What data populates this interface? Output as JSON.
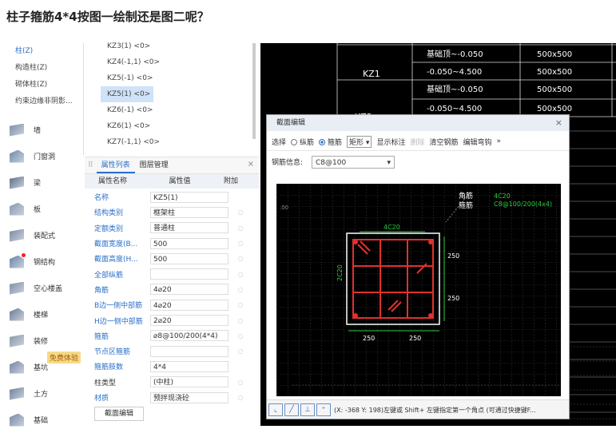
{
  "question": "柱子箍筋4*4按图一绘制还是图二呢？",
  "top_glyph": "^",
  "categories": [
    {
      "label": "柱(Z)",
      "selected": true
    },
    {
      "label": "构造柱(Z)",
      "selected": false
    },
    {
      "label": "砌体柱(Z)",
      "selected": false
    },
    {
      "label": "约束边缘非阴影...",
      "selected": false
    }
  ],
  "nav": [
    {
      "label": "墙",
      "icon": "wall-icon"
    },
    {
      "label": "门窗洞",
      "icon": "door-window-icon"
    },
    {
      "label": "梁",
      "icon": "beam-icon"
    },
    {
      "label": "板",
      "icon": "slab-icon"
    },
    {
      "label": "装配式",
      "icon": "prefab-icon"
    },
    {
      "label": "钢结构",
      "icon": "steel-structure-icon"
    },
    {
      "label": "空心楼盖",
      "icon": "hollow-floor-icon"
    },
    {
      "label": "楼梯",
      "icon": "stair-icon"
    },
    {
      "label": "装修",
      "icon": "decoration-icon"
    },
    {
      "label": "基坑",
      "icon": "pit-icon"
    },
    {
      "label": "土方",
      "icon": "earthwork-icon"
    },
    {
      "label": "基础",
      "icon": "foundation-icon"
    }
  ],
  "free_badge": "免费体验",
  "components": [
    {
      "label": "KZ3(1) <0>",
      "selected": false
    },
    {
      "label": "KZ4(-1,1) <0>",
      "selected": false
    },
    {
      "label": "KZ5(-1) <0>",
      "selected": false
    },
    {
      "label": "KZ5(1) <0>",
      "selected": true
    },
    {
      "label": "KZ6(-1) <0>",
      "selected": false
    },
    {
      "label": "KZ6(1) <0>",
      "selected": false
    },
    {
      "label": "KZ7(-1,1) <0>",
      "selected": false
    }
  ],
  "props": {
    "tabs": [
      "属性列表",
      "图层管理"
    ],
    "grip": "⠿",
    "close": "×",
    "headers": [
      "属性名称",
      "属性值",
      "附加"
    ],
    "rows": [
      {
        "name": "名称",
        "value": "KZ5(1)",
        "link": true,
        "check": false
      },
      {
        "name": "结构类别",
        "value": "框架柱",
        "link": true,
        "check": true
      },
      {
        "name": "定额类别",
        "value": "普通柱",
        "link": true,
        "check": true
      },
      {
        "name": "截面宽度(B...",
        "value": "500",
        "link": true,
        "check": true
      },
      {
        "name": "截面高度(H...",
        "value": "500",
        "link": true,
        "check": true
      },
      {
        "name": "全部纵筋",
        "value": "",
        "link": true,
        "check": true
      },
      {
        "name": "角筋",
        "value": "4⌀20",
        "link": true,
        "check": true
      },
      {
        "name": "B边一侧中部筋",
        "value": "4⌀20",
        "link": true,
        "check": true
      },
      {
        "name": "H边一侧中部筋",
        "value": "2⌀20",
        "link": true,
        "check": true
      },
      {
        "name": "箍筋",
        "value": "⌀8@100/200(4*4)",
        "link": true,
        "check": true
      },
      {
        "name": "节点区箍筋",
        "value": "",
        "link": true,
        "check": true
      },
      {
        "name": "箍筋肢数",
        "value": "4*4",
        "link": true,
        "check": false
      },
      {
        "name": "柱类型",
        "value": "(中柱)",
        "link": false,
        "check": true
      },
      {
        "name": "材质",
        "value": "预拌现浇砼",
        "link": true,
        "check": true
      }
    ],
    "section_button": "截面编辑"
  },
  "cad_table": {
    "rows": [
      {
        "name": "KZ1",
        "elev": "基础顶~-0.050",
        "size": "500x500"
      },
      {
        "name": "",
        "elev": "-0.050~4.500",
        "size": "500x500"
      },
      {
        "name": "KZ2",
        "elev": "基础顶~-0.050",
        "size": "500x500"
      },
      {
        "name": "",
        "elev": "-0.050~4.500",
        "size": "500x500"
      }
    ]
  },
  "dialog": {
    "title": "截面编辑",
    "close": "×",
    "toolbar": {
      "select": "选择",
      "longitudinal": "纵筋",
      "stirrup": "箍筋",
      "shape": "矩形",
      "show_label": "显示标注",
      "delete": "删除",
      "clear": "清空钢筋",
      "edit_hook": "编辑弯钩",
      "more": "»"
    },
    "rebar_info_label": "钢筋信息:",
    "rebar_info_value": "C8@100",
    "canvas": {
      "corner_label": "角筋",
      "stirrup_label": "箍筋",
      "corner_value": "4C20",
      "stirrup_value": "C8@100/200(4x4)",
      "top_bar": "4C20",
      "side_bar": "2C20",
      "dim_250": "250"
    },
    "status": "(X: -368 Y: 198)左键或 Shift+ 左键指定第一个角点 (可通过快捷键F..."
  },
  "colors": {
    "accent": "#2a6fc9",
    "rebar": "#e23030",
    "cad_green": "#2ecc40"
  }
}
